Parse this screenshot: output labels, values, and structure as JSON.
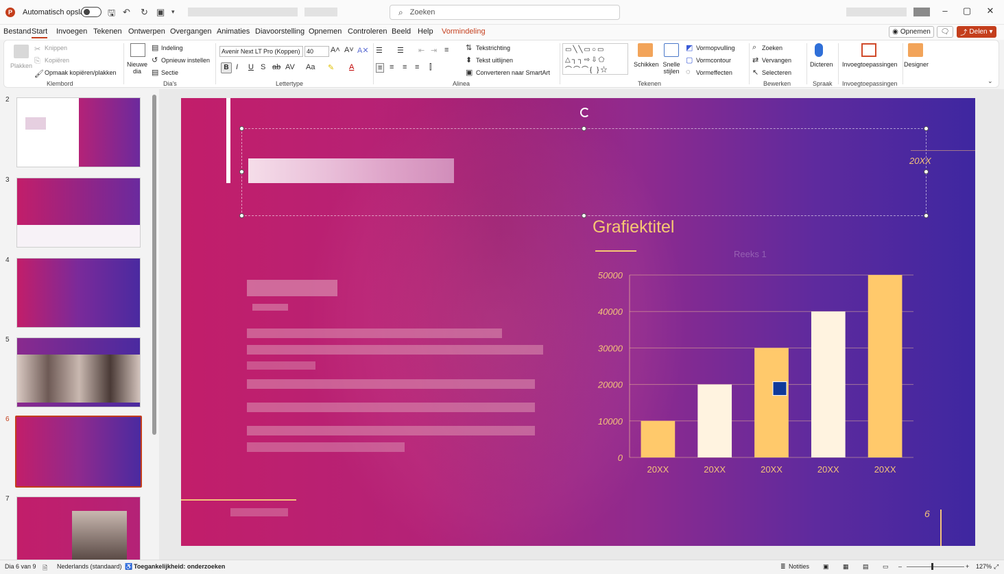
{
  "titlebar": {
    "autosave_label": "Automatisch opslaan",
    "search_placeholder": "Zoeken"
  },
  "menu": {
    "items": [
      "Bestand",
      "Start",
      "Invoegen",
      "Tekenen",
      "Ontwerpen",
      "Overgangen",
      "Animaties",
      "Diavoorstelling",
      "Opnemen",
      "Controleren",
      "Beeld",
      "Help",
      "Vormindeling"
    ],
    "active": "Start",
    "opnemen_label": "Opnemen",
    "delen_label": "Delen"
  },
  "ribbon": {
    "klembord": {
      "label": "Klembord",
      "plakken": "Plakken",
      "knippen": "Knippen",
      "kopieren": "Kopiëren",
      "opmaak": "Opmaak kopiëren/plakken"
    },
    "dias": {
      "label": "Dia's",
      "nieuwe_dia": "Nieuwe dia",
      "indeling": "Indeling",
      "opnieuw": "Opnieuw instellen",
      "sectie": "Sectie"
    },
    "lettertype": {
      "label": "Lettertype",
      "font": "Avenir Next LT Pro (Koppen)",
      "size": "40"
    },
    "alinea": {
      "label": "Alinea",
      "tekstrichting": "Tekstrichting",
      "uitlijnen": "Tekst uitlijnen",
      "smartart": "Converteren naar SmartArt"
    },
    "tekenen": {
      "label": "Tekenen",
      "schikken": "Schikken",
      "snelle_stijlen": "Snelle stijlen",
      "vormopvulling": "Vormopvulling",
      "vormcontour": "Vormcontour",
      "vormeffecten": "Vormeffecten"
    },
    "bewerken": {
      "label": "Bewerken",
      "zoeken": "Zoeken",
      "vervangen": "Vervangen",
      "selecteren": "Selecteren"
    },
    "spraak": {
      "label": "Spraak",
      "dicteren": "Dicteren"
    },
    "invoeg": {
      "label": "Invoegtoepassingen",
      "button": "Invoegtoepassingen"
    },
    "designer": "Designer"
  },
  "thumbnails": {
    "numbers": [
      "2",
      "3",
      "4",
      "5",
      "6",
      "7"
    ],
    "selected": "6"
  },
  "slide": {
    "date": "20XX",
    "page_number": "6"
  },
  "chart_data": {
    "type": "bar",
    "title": "Grafiektitel",
    "categories": [
      "20XX",
      "20XX",
      "20XX",
      "20XX",
      "20XX"
    ],
    "series": [
      {
        "name": "Reeks 1",
        "values": [
          10000,
          20000,
          30000,
          40000,
          50000
        ]
      }
    ],
    "colors": [
      "#ffc96b",
      "#fff3e0",
      "#ffc96b",
      "#fff3e0",
      "#ffc96b"
    ],
    "yticks": [
      "50000",
      "40000",
      "30000",
      "20000",
      "10000",
      "0"
    ],
    "ylim": [
      0,
      50000
    ],
    "grid": true,
    "legend": "none"
  },
  "statusbar": {
    "slide_info": "Dia 6 van 9",
    "language": "Nederlands (standaard)",
    "accessibility": "Toegankelijkheid: onderzoeken",
    "notes": "Notities",
    "zoom": "127%"
  },
  "colors": {
    "accent": "#c43e1c",
    "chart_gold": "#ffc96b",
    "chart_cream": "#fff3e0"
  }
}
